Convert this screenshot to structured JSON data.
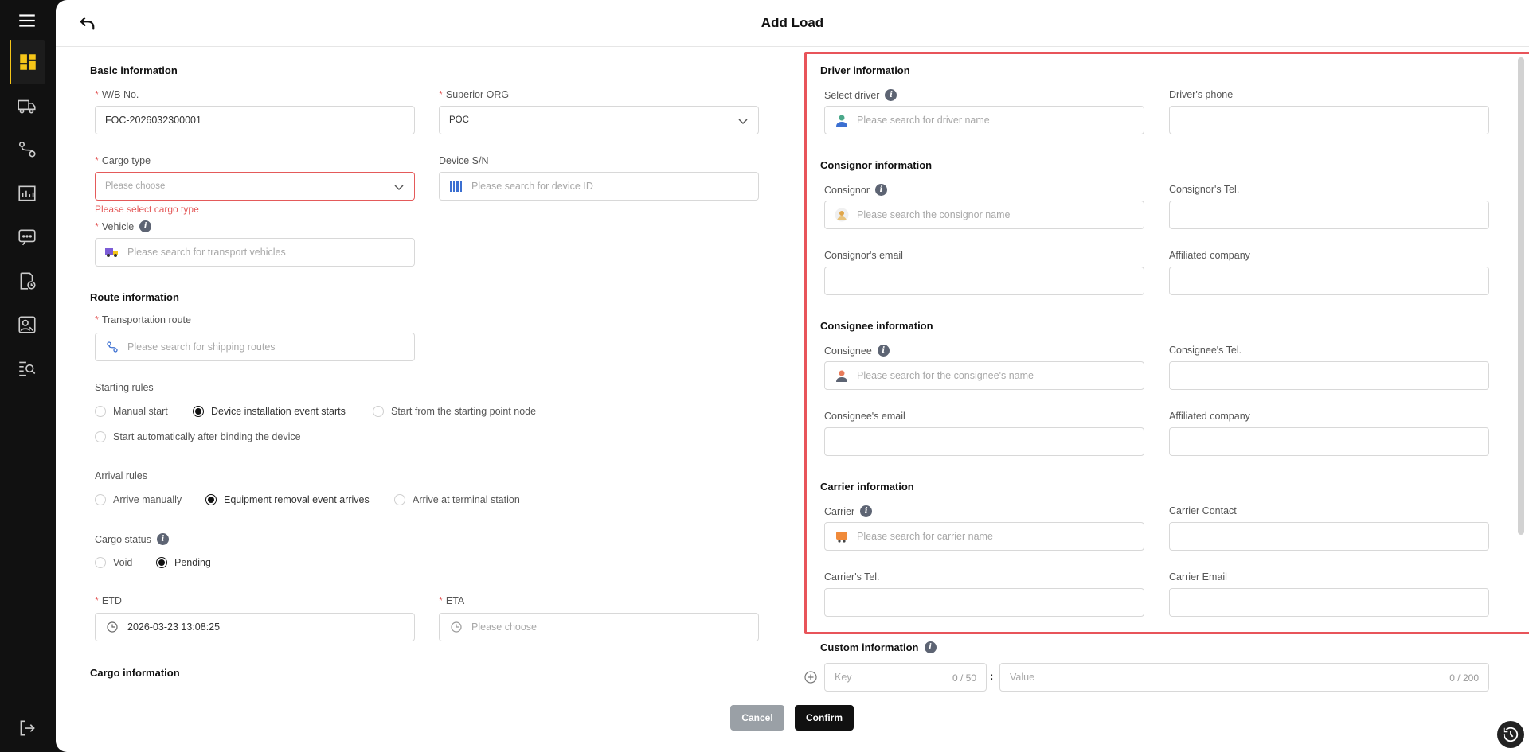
{
  "page": {
    "title": "Add Load"
  },
  "sidebar": {
    "items": [
      {
        "icon": "dashboard-icon"
      },
      {
        "icon": "truck-icon"
      },
      {
        "icon": "route-icon"
      },
      {
        "icon": "report-icon"
      },
      {
        "icon": "message-icon"
      },
      {
        "icon": "document-clock-icon"
      },
      {
        "icon": "person-search-icon"
      },
      {
        "icon": "list-search-icon"
      },
      {
        "icon": "logout-icon"
      }
    ]
  },
  "basic": {
    "title": "Basic information",
    "wb_label": "W/B No.",
    "wb_value": "FOC-2026032300001",
    "org_label": "Superior ORG",
    "org_value": "POC",
    "cargo_type_label": "Cargo type",
    "cargo_type_placeholder": "Please choose",
    "cargo_type_error": "Please select cargo type",
    "device_label": "Device S/N",
    "device_placeholder": "Please search for device ID",
    "vehicle_label": "Vehicle",
    "vehicle_placeholder": "Please search for transport vehicles"
  },
  "route": {
    "title": "Route information",
    "route_label": "Transportation route",
    "route_placeholder": "Please search for shipping routes",
    "starting_rules_label": "Starting rules",
    "starting_rules": [
      "Manual start",
      "Device installation event starts",
      "Start from the starting point node",
      "Start automatically after binding the device"
    ],
    "starting_selected": "Device installation event starts",
    "arrival_rules_label": "Arrival rules",
    "arrival_rules": [
      "Arrive manually",
      "Equipment removal event arrives",
      "Arrive at terminal station"
    ],
    "arrival_selected": "Equipment removal event arrives",
    "cargo_status_label": "Cargo status",
    "cargo_status": [
      "Void",
      "Pending"
    ],
    "cargo_status_selected": "Pending",
    "etd_label": "ETD",
    "etd_value": "2026-03-23 13:08:25",
    "eta_label": "ETA",
    "eta_placeholder": "Please choose"
  },
  "cargo": {
    "title": "Cargo information"
  },
  "driver": {
    "title": "Driver information",
    "select_label": "Select driver",
    "select_placeholder": "Please search for driver name",
    "phone_label": "Driver's phone"
  },
  "consignor": {
    "title": "Consignor information",
    "name_label": "Consignor",
    "name_placeholder": "Please search the consignor name",
    "tel_label": "Consignor's Tel.",
    "email_label": "Consignor's email",
    "company_label": "Affiliated company"
  },
  "consignee": {
    "title": "Consignee information",
    "name_label": "Consignee",
    "name_placeholder": "Please search for the consignee's name",
    "tel_label": "Consignee's Tel.",
    "email_label": "Consignee's email",
    "company_label": "Affiliated company"
  },
  "carrier": {
    "title": "Carrier information",
    "name_label": "Carrier",
    "name_placeholder": "Please search for carrier name",
    "contact_label": "Carrier Contact",
    "tel_label": "Carrier's Tel.",
    "email_label": "Carrier Email"
  },
  "custom": {
    "title": "Custom information",
    "key_placeholder": "Key",
    "key_counter": "0 / 50",
    "separator": ":",
    "value_placeholder": "Value",
    "value_counter": "0 / 200"
  },
  "footer": {
    "cancel": "Cancel",
    "confirm": "Confirm"
  },
  "colors": {
    "accent": "#f5c518",
    "error": "#e45a5a",
    "highlight": "#e8545a"
  }
}
